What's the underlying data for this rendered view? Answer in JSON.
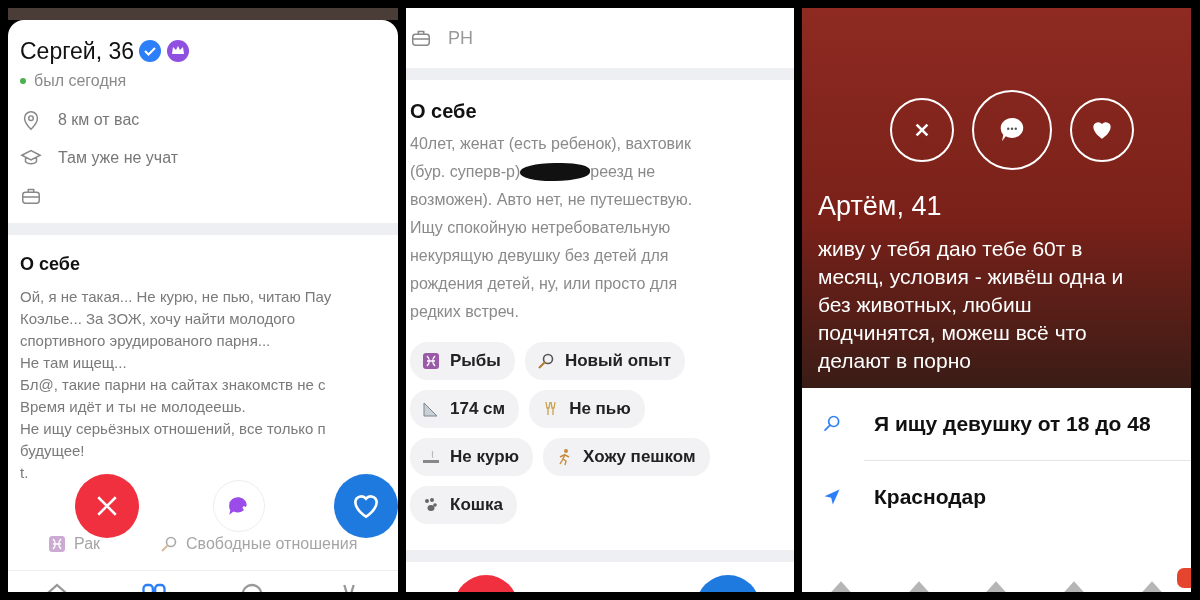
{
  "profile_1": {
    "name": "Сергей, 36",
    "verified": true,
    "premium": true,
    "online": true,
    "last_seen": "был сегодня",
    "details": [
      {
        "kind": "location",
        "text": "8 км от вас"
      },
      {
        "kind": "education",
        "text": "Там уже не учат"
      },
      {
        "kind": "work"
      }
    ],
    "about_title": "О себе",
    "about_text": "Ой, я не такая... Не курю, не пью, читаю Пау\nКоэлье... За ЗОЖ, хочу найти молодого\nспортивного эрудированого парня...\nНе там ищещ...\nБл@, такие парни на сайтах знакомств не с\nВремя идёт и ты не молодеешь.\nНе ищу серьёзных отношений, все только п\nбудущее!",
    "contact": "t.",
    "tags": [
      {
        "kind": "zodiac",
        "label": "Рак"
      },
      {
        "kind": "search",
        "label": "Свободные отношения"
      }
    ]
  },
  "profile_2": {
    "work": "РН",
    "about_title": "О себе",
    "about_first_line": "40лет, женат (есть ребенок), вахтовик",
    "about_before_redaction": "(бур. суперв-р)",
    "about_after_redaction": "реезд не",
    "about_rest": "возможен). Авто нет, не путешествую.\nИщу спокойную нетребовательную\nнекурящую девушку без детей для\nрождения детей, ну, или просто для\nредких встреч.",
    "tags": [
      {
        "kind": "zodiac",
        "label": "Рыбы"
      },
      {
        "kind": "search",
        "label": "Новый опыт"
      },
      {
        "kind": "height",
        "label": "174 см"
      },
      {
        "kind": "alcohol",
        "label": "Не пью"
      },
      {
        "kind": "smoking",
        "label": "Не курю"
      },
      {
        "kind": "sport",
        "label": "Хожу пешком"
      },
      {
        "kind": "pets",
        "label": "Кошка"
      }
    ]
  },
  "profile_3": {
    "name": "Артём, 41",
    "bio": "живу у тебя даю тебе 60т в\nмесяц, условия - живёш одна и\nбез животных, любиш\nподчинятся, можеш всё что\nделают в порно",
    "looking_for": "Я ищу девушку от 18 до 48",
    "city": "Краснодар"
  }
}
